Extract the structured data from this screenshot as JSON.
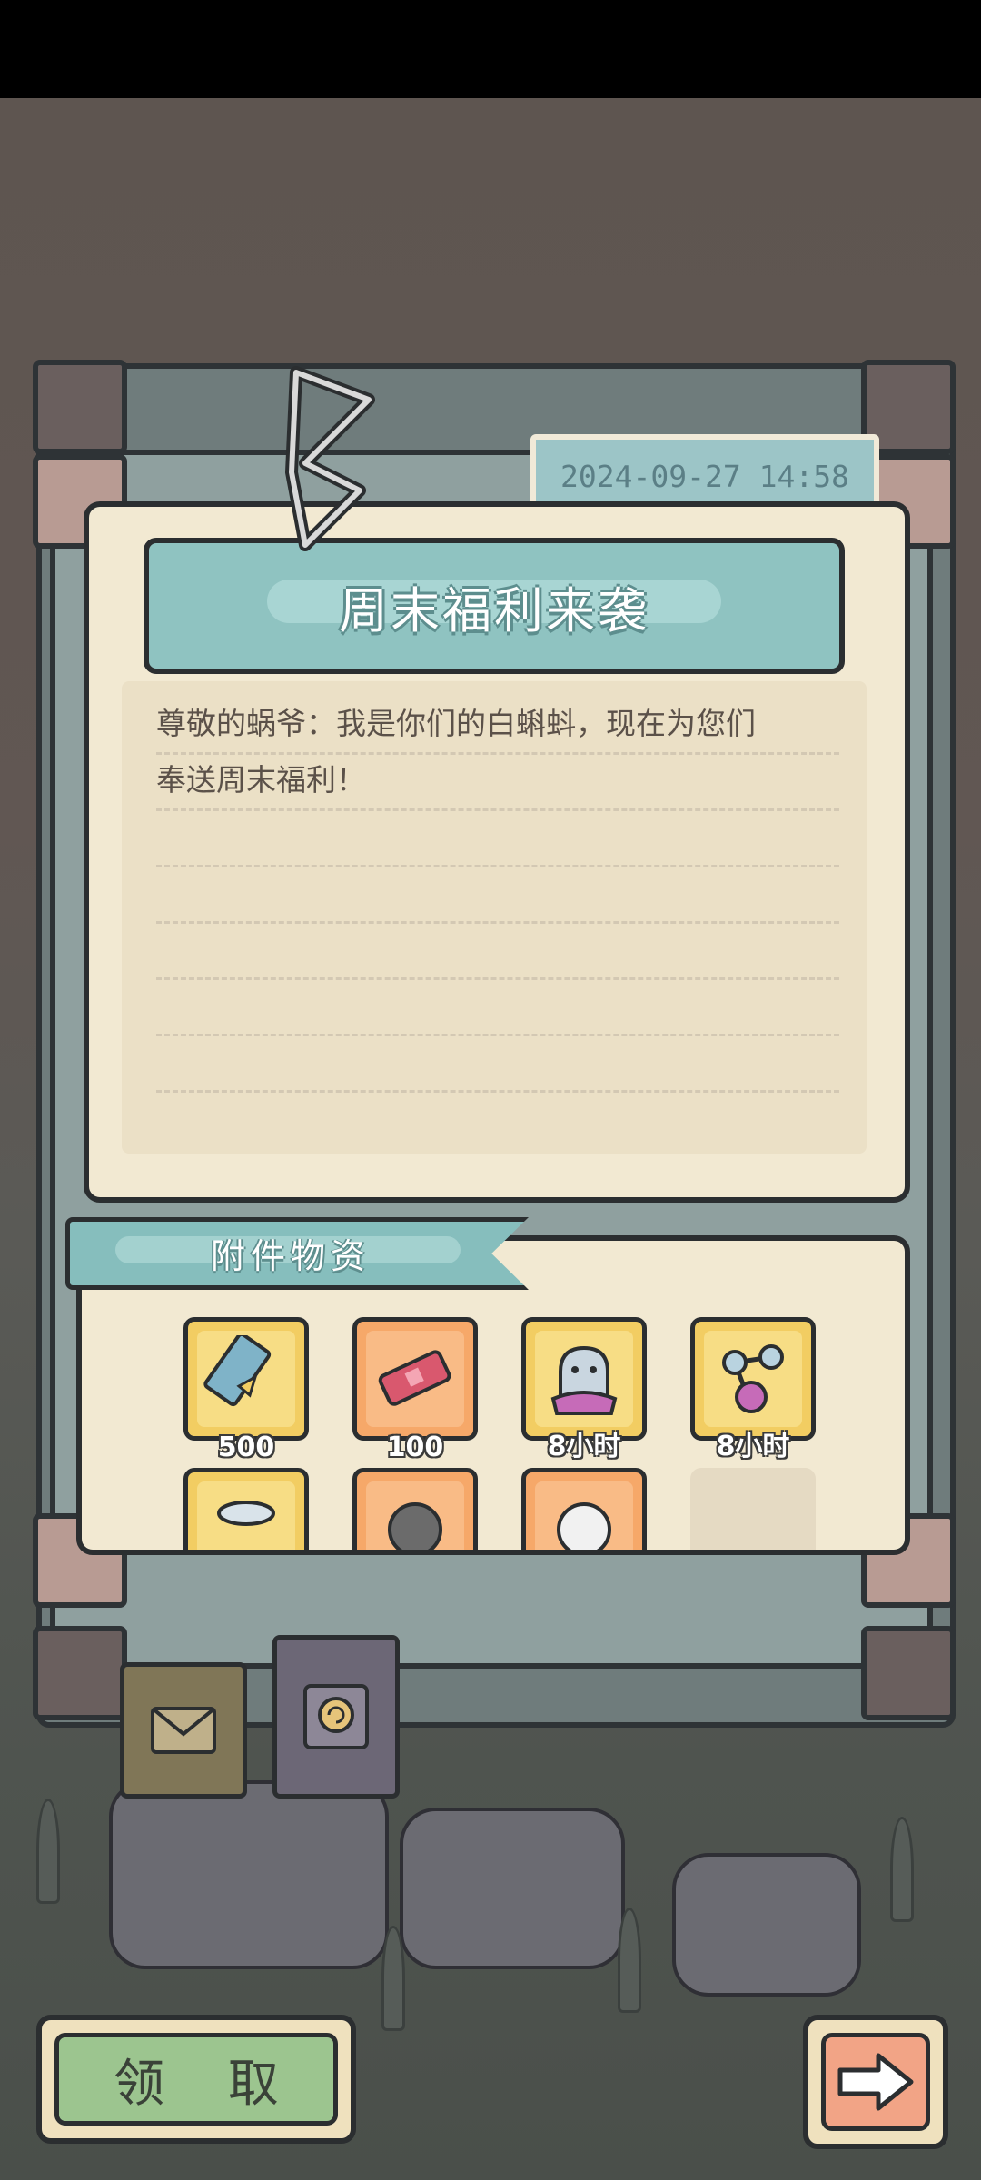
{
  "mail": {
    "date": "2024-09-27  14:58",
    "title": "周末福利来袭",
    "body_line1": "尊敬的蜗爷：我是你们的白蝌蚪，现在为您们",
    "body_line2": "奉送周末福利！"
  },
  "attachments": {
    "label": "附件物资",
    "items": [
      {
        "icon": "film-reel-icon",
        "qty": "500"
      },
      {
        "icon": "ticket-icon",
        "qty": "100"
      },
      {
        "icon": "ghost-jelly-icon",
        "qty": "8小时"
      },
      {
        "icon": "potion-molecule-icon",
        "qty": "8小时"
      }
    ]
  },
  "tabs": [
    {
      "icon": "envelope-icon"
    },
    {
      "icon": "snail-badge-icon"
    }
  ],
  "actions": {
    "claim_label": "领 取"
  },
  "colors": {
    "teal": "#8fc3c1",
    "paper": "#f2e9d2",
    "claim_green": "#9cc58f",
    "next_orange": "#f2a486"
  }
}
